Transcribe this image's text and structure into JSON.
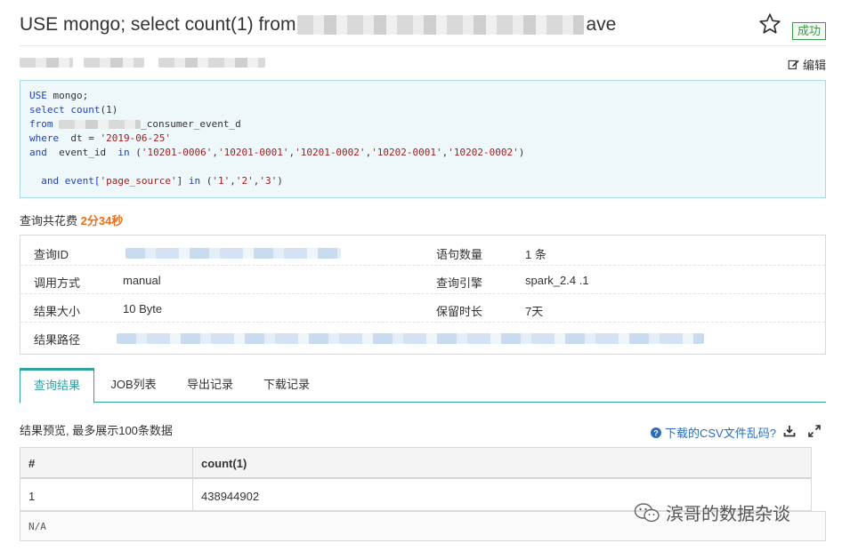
{
  "header": {
    "title_start": "USE mongo; select count(1) from",
    "title_end": "ave",
    "status": "成功"
  },
  "toolbar": {
    "edit_label": "编辑"
  },
  "code": {
    "line1_kw": "USE",
    "line1_rest": " mongo;",
    "line2_kw": "select",
    "line2_fn": " count",
    "line2_rest": "(1)",
    "line3_kw": "from",
    "line3_suffix": "_consumer_event_d",
    "line4_kw": "where",
    "line4_mid": "  dt = ",
    "line4_str": "'2019-06-25'",
    "line5_kw": "and",
    "line5_mid": "  event_id  ",
    "line5_in": "in",
    "line5_open": " (",
    "line5_vals": [
      "'10201-0006'",
      "'10201-0001'",
      "'10201-0002'",
      "'10202-0001'",
      "'10202-0002'"
    ],
    "line5_close": ")",
    "line7_kw": "and",
    "line7_mid": " event[",
    "line7_key": "'page_source'",
    "line7_mid2": "] ",
    "line7_in": "in",
    "line7_open": " (",
    "line7_vals": [
      "'1'",
      "'2'",
      "'3'"
    ],
    "line7_close": ")"
  },
  "cost": {
    "label": "查询共花费 ",
    "value": "2分34秒"
  },
  "info": {
    "query_id_label": "查询ID",
    "statement_count_label": "语句数量",
    "statement_count_value": "1 条",
    "call_mode_label": "调用方式",
    "call_mode_value": "manual",
    "engine_label": "查询引擎",
    "engine_value": "spark_2.4 .1",
    "result_size_label": "结果大小",
    "result_size_value": "10 Byte",
    "retention_label": "保留时长",
    "retention_value": "7天",
    "result_path_label": "结果路径"
  },
  "tabs": [
    "查询结果",
    "JOB列表",
    "导出记录",
    "下载记录"
  ],
  "preview": {
    "label": "结果预览, 最多展示100条数据",
    "csv_help": "下载的CSV文件乱码?"
  },
  "result_table": {
    "columns": [
      "#",
      "count(1)"
    ],
    "rows": [
      [
        "1",
        "438944902"
      ]
    ]
  },
  "footer_note": "N/A",
  "watermark": "滨哥的数据杂谈",
  "colors": {
    "accent": "#2ea3a0",
    "success": "#3c9a4a",
    "cost": "#e8701a",
    "link": "#2a6ebb"
  }
}
